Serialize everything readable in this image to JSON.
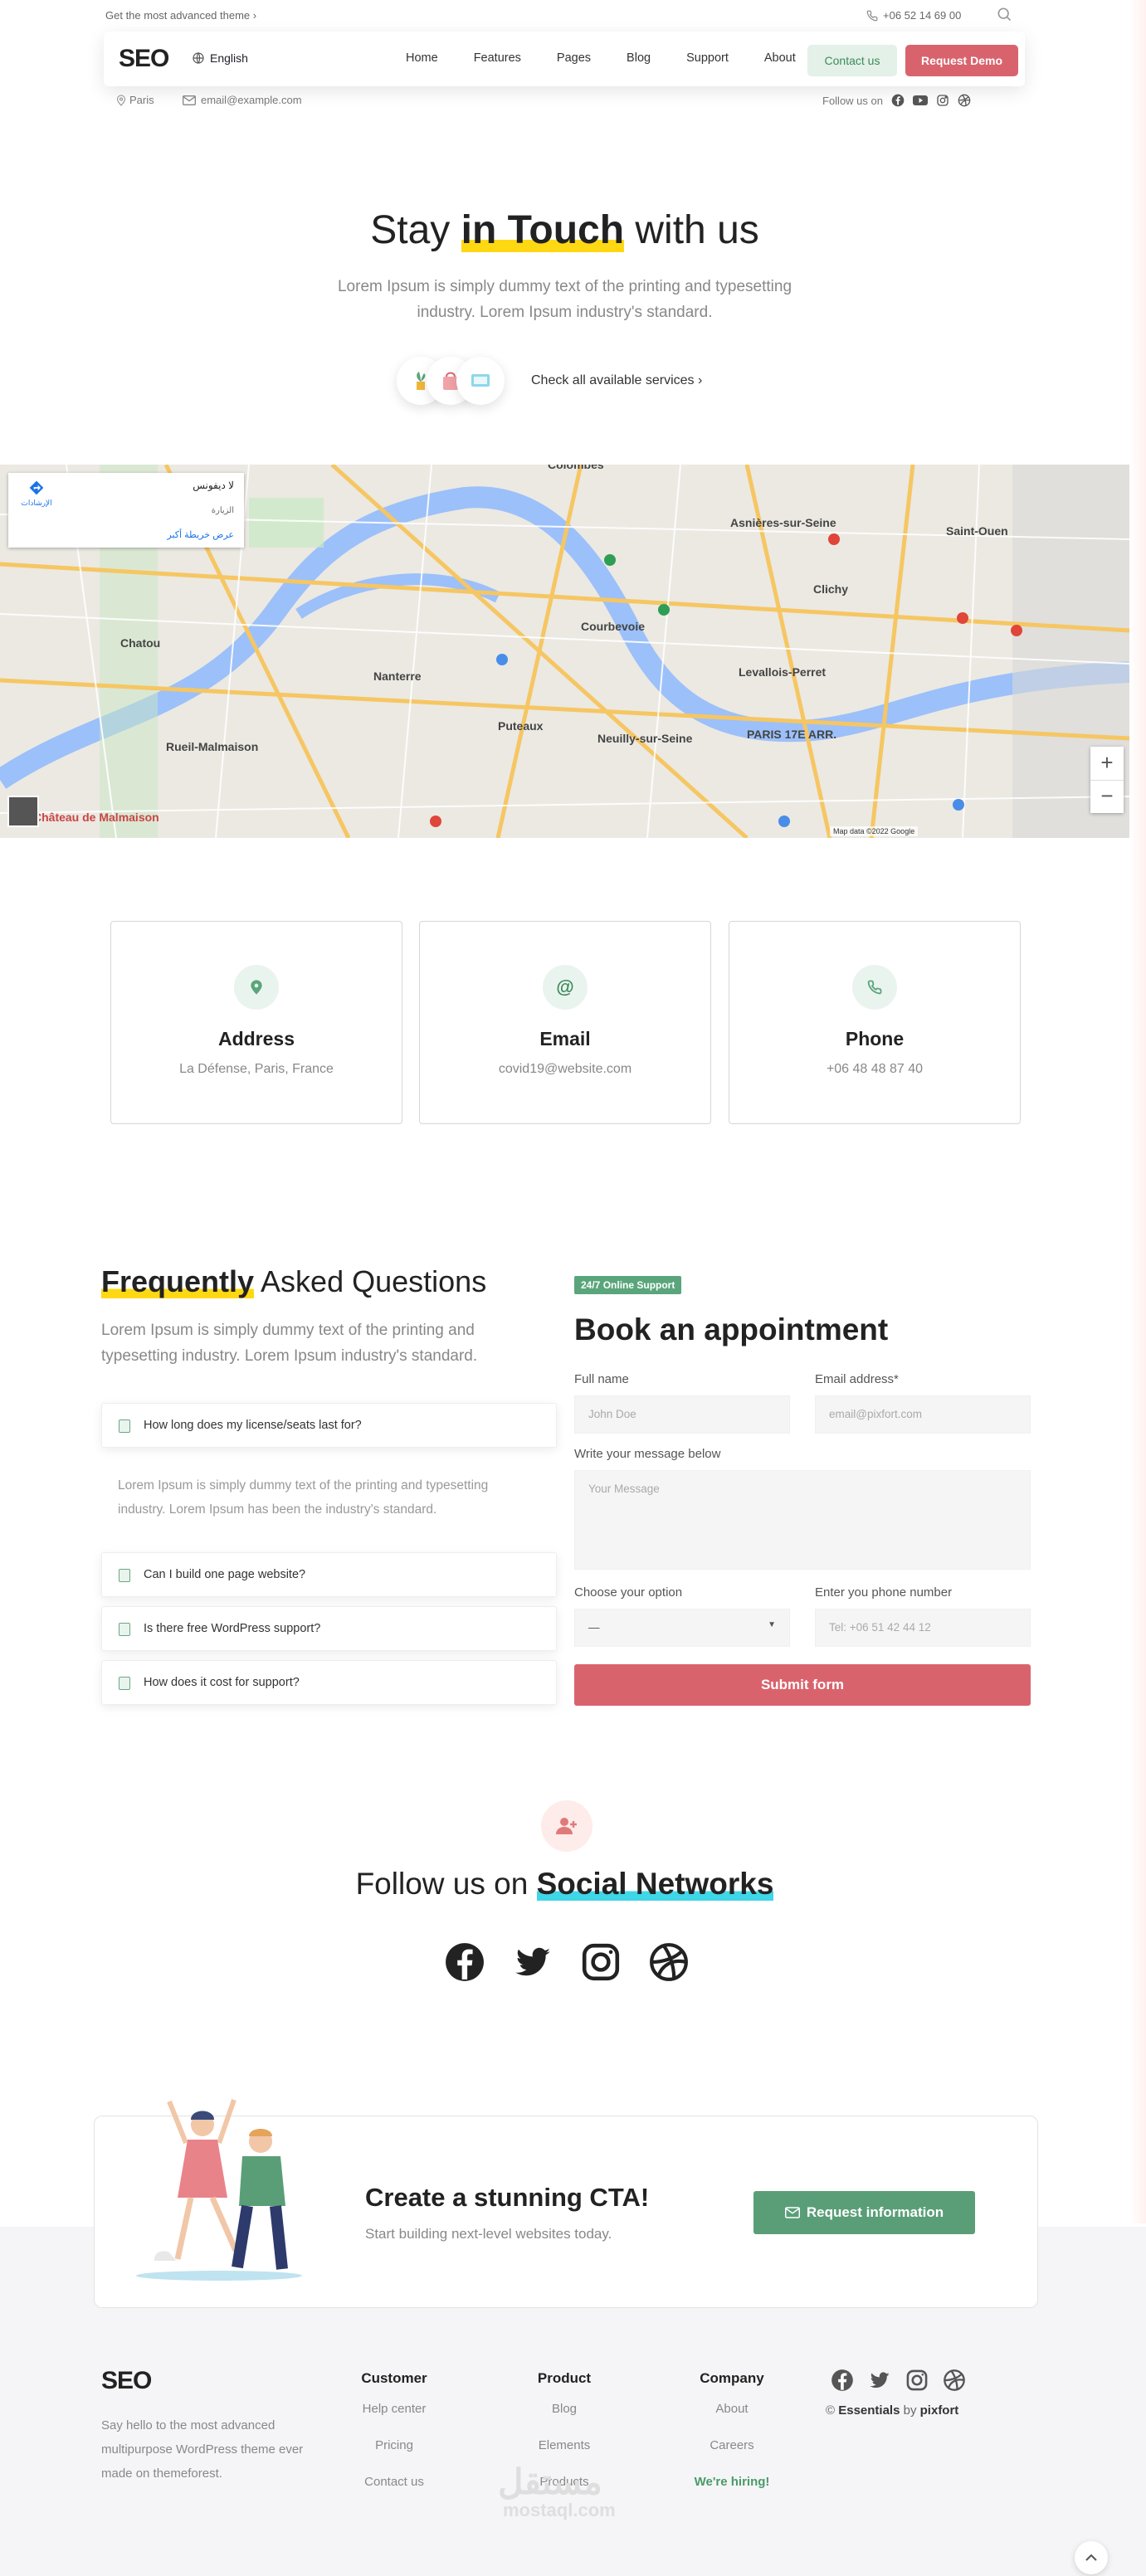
{
  "topbar": {
    "promo": "Get the most advanced theme",
    "phone": "+06 52 14 69 00"
  },
  "nav": {
    "logo": "SEO",
    "language": "English",
    "links": [
      "Home",
      "Features",
      "Pages",
      "Blog",
      "Support",
      "About"
    ],
    "contact_button": "Contact us",
    "demo_button": "Request Demo"
  },
  "subnav": {
    "location": "Paris",
    "email": "email@example.com",
    "follow": "Follow us on"
  },
  "hero": {
    "title_prefix": "Stay",
    "title_highlight": "in Touch",
    "title_suffix": "with us",
    "subtitle": "Lorem Ipsum is simply dummy text of the printing and typesetting industry. Lorem Ipsum industry's standard.",
    "services_link": "Check all available services"
  },
  "map": {
    "card_title": "لا ديفونس",
    "card_sub": "الإرشادات",
    "card_link": "عرض خريطة أكبر",
    "attribution": "Map data ©2022 Google",
    "labels": [
      "Courbevoie",
      "Nanterre",
      "Levallois-Perret",
      "Neuilly-sur-Seine",
      "Rueil-Malmaison",
      "Clichy",
      "Asnières-sur-Seine",
      "Puteaux",
      "PARIS 17E ARR.",
      "Colombes",
      "Saint-Ouen",
      "Chatou",
      "Château de Malmaison"
    ]
  },
  "contact_cards": [
    {
      "icon": "location-icon",
      "title": "Address",
      "value": "La Défense, Paris, France"
    },
    {
      "icon": "at-icon",
      "title": "Email",
      "value": "covid19@website.com"
    },
    {
      "icon": "phone-icon",
      "title": "Phone",
      "value": "+06 48 48 87 40"
    }
  ],
  "faq": {
    "title_highlight": "Frequently",
    "title_suffix": "Asked Questions",
    "subtitle": "Lorem Ipsum is simply dummy text of the printing and typesetting industry. Lorem Ipsum industry's standard.",
    "items": [
      "How long does my license/seats last for?",
      "Can I build one page website?",
      "Is there free WordPress support?",
      "How does it cost for support?"
    ],
    "answer": "Lorem Ipsum is simply dummy text of the printing and typesetting industry. Lorem Ipsum has been the industry's standard."
  },
  "appointment": {
    "badge": "24/7 Online Support",
    "title": "Book an appointment",
    "full_name_label": "Full name",
    "full_name_placeholder": "John Doe",
    "email_label": "Email address*",
    "email_placeholder": "email@pixfort.com",
    "message_label": "Write your message below",
    "message_placeholder": "Your Message",
    "option_label": "Choose your option",
    "option_value": "—",
    "phone_label": "Enter you phone number",
    "phone_placeholder": "Tel: +06 51 42 44 12",
    "submit": "Submit form"
  },
  "social": {
    "title_prefix": "Follow us on",
    "title_highlight": "Social Networks",
    "icons": [
      "facebook-icon",
      "twitter-icon",
      "instagram-icon",
      "dribbble-icon"
    ]
  },
  "cta": {
    "title": "Create a stunning CTA!",
    "subtitle": "Start building next-level websites today.",
    "button": "Request information"
  },
  "footer": {
    "logo": "SEO",
    "description": "Say hello to the most advanced multipurpose WordPress theme ever made on themeforest.",
    "columns": [
      {
        "title": "Customer",
        "links": [
          "Help center",
          "Pricing",
          "Contact us"
        ]
      },
      {
        "title": "Product",
        "links": [
          "Blog",
          "Elements",
          "Products"
        ]
      },
      {
        "title": "Company",
        "links": [
          "About",
          "Careers",
          "We're hiring!"
        ]
      }
    ],
    "credit_prefix": "©",
    "credit_brand": "Essentials",
    "credit_by": "by",
    "credit_author": "pixfort",
    "watermark": "مستقل",
    "watermark_sub": "mostaql.com"
  },
  "colors": {
    "accent_red": "#d9636d",
    "accent_green": "#5aa57b",
    "highlight_yellow": "#ffd814",
    "highlight_cyan": "#3fd6e8"
  }
}
